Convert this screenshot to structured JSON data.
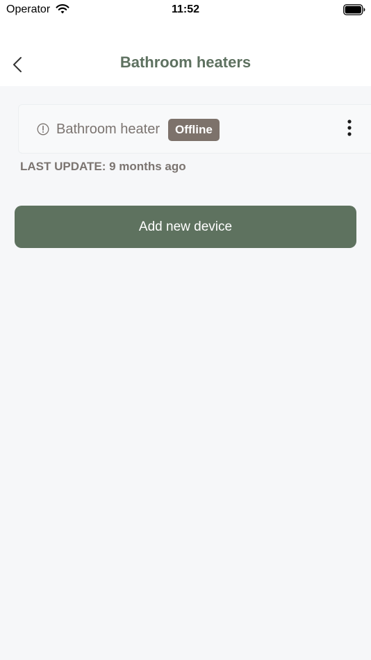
{
  "status_bar": {
    "carrier": "Operator",
    "time": "11:52",
    "wifi_icon": "wifi-icon",
    "battery_icon": "battery-full-icon"
  },
  "nav": {
    "title": "Bathroom heaters",
    "back_icon": "chevron-left-icon"
  },
  "device": {
    "name": "Bathroom heater",
    "status": "Offline",
    "status_icon": "alert-circle-icon",
    "menu_icon": "more-vertical-icon",
    "last_update": "LAST UPDATE: 9 months ago"
  },
  "actions": {
    "add_device_label": "Add new device"
  },
  "colors": {
    "accent": "#5e725f",
    "title": "#5e7160",
    "badge_bg": "#7d726b",
    "text_muted": "#7b7470",
    "background": "#f6f7f9"
  }
}
